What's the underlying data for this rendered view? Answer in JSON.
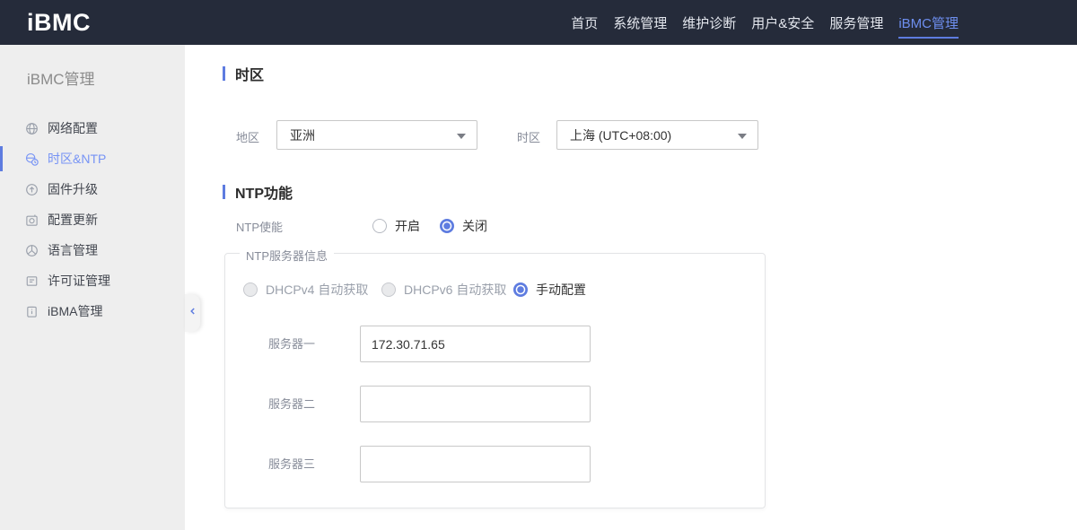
{
  "header": {
    "logo": "iBMC",
    "nav": [
      {
        "label": "首页",
        "active": false
      },
      {
        "label": "系统管理",
        "active": false
      },
      {
        "label": "维护诊断",
        "active": false
      },
      {
        "label": "用户&安全",
        "active": false
      },
      {
        "label": "服务管理",
        "active": false
      },
      {
        "label": "iBMC管理",
        "active": true
      }
    ]
  },
  "sidebar": {
    "title": "iBMC管理",
    "items": [
      {
        "label": "网络配置",
        "icon": "network-icon",
        "active": false
      },
      {
        "label": "时区&NTP",
        "icon": "timezone-icon",
        "active": true
      },
      {
        "label": "固件升级",
        "icon": "firmware-upgrade-icon",
        "active": false
      },
      {
        "label": "配置更新",
        "icon": "config-update-icon",
        "active": false
      },
      {
        "label": "语言管理",
        "icon": "language-icon",
        "active": false
      },
      {
        "label": "许可证管理",
        "icon": "license-icon",
        "active": false
      },
      {
        "label": "iBMA管理",
        "icon": "ibma-icon",
        "active": false
      }
    ]
  },
  "main": {
    "timezone_section": {
      "title": "时区",
      "region_label": "地区",
      "region_value": "亚洲",
      "timezone_label": "时区",
      "timezone_value": "上海 (UTC+08:00)"
    },
    "ntp_section": {
      "title": "NTP功能",
      "enable_label": "NTP使能",
      "enable_options": [
        {
          "label": "开启",
          "checked": false
        },
        {
          "label": "关闭",
          "checked": true
        }
      ],
      "server_group": {
        "legend": "NTP服务器信息",
        "mode_options": [
          {
            "label": "DHCPv4 自动获取",
            "checked": false,
            "disabled": true
          },
          {
            "label": "DHCPv6 自动获取",
            "checked": false,
            "disabled": true
          },
          {
            "label": "手动配置",
            "checked": true,
            "disabled": false
          }
        ],
        "servers": [
          {
            "label": "服务器一",
            "value": "172.30.71.65"
          },
          {
            "label": "服务器二",
            "value": ""
          },
          {
            "label": "服务器三",
            "value": ""
          }
        ]
      }
    }
  },
  "colors": {
    "accent": "#5e7ce0",
    "header_bg": "#252b3a",
    "sidebar_bg": "#eeeeee",
    "nav_active": "#6e8ff0"
  }
}
